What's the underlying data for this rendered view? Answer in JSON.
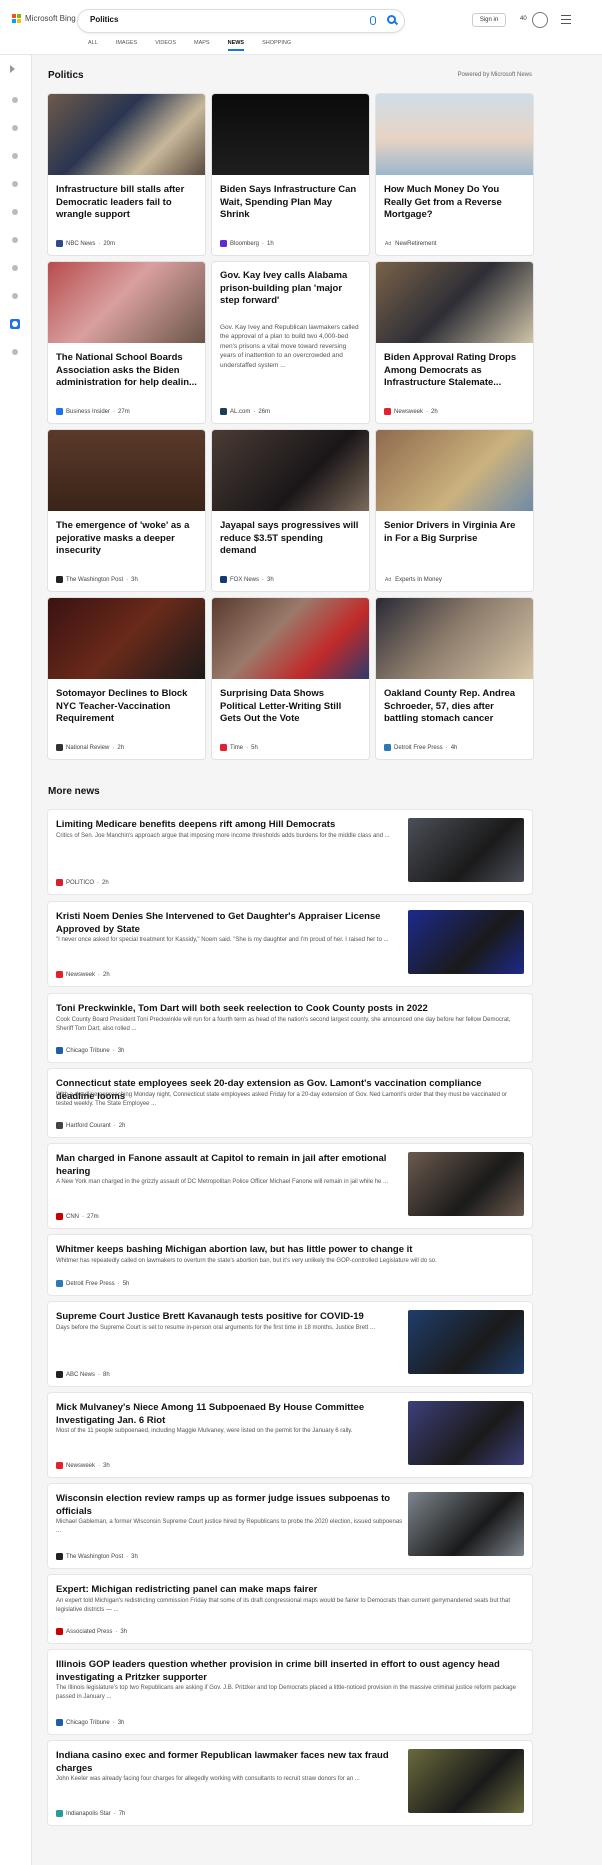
{
  "header": {
    "logo_text": "Microsoft Bing",
    "search_value": "Politics",
    "sign_in": "Sign in",
    "points": "40"
  },
  "tabs": [
    "ALL",
    "IMAGES",
    "VIDEOS",
    "MAPS",
    "NEWS",
    "SHOPPING"
  ],
  "section": {
    "title": "Politics",
    "powered_by": "Powered by Microsoft News"
  },
  "cards": [
    {
      "title": "Infrastructure bill stalls after Democratic leaders fail to wrangle support",
      "source": "NBC News",
      "time": "20m",
      "icon": "nbc-icon",
      "color": "#2d4a8a"
    },
    {
      "title": "Biden Says Infrastructure Can Wait, Spending Plan May Shrink",
      "source": "Bloomberg",
      "time": "1h",
      "icon": "bloomberg-icon",
      "color": "#5b2bd6"
    },
    {
      "title": "How Much Money Do You Really Get from a Reverse Mortgage?",
      "source": "NewRetirement",
      "time": "",
      "ad": "Ad",
      "icon": "ad-icon",
      "color": "#999999"
    },
    {
      "title": "The National School Boards Association asks the Biden administration for help dealin...",
      "source": "Business Insider",
      "time": "27m",
      "icon": "business-insider-icon",
      "color": "#1a73e8"
    },
    {
      "title": "Gov. Kay Ivey calls Alabama prison-building plan 'major step forward'",
      "desc": "Gov. Kay Ivey and Republican lawmakers called the approval of a plan to build two 4,000-bed men's prisons a vital move toward reversing years of inattention to an overcrowded and understaffed system ...",
      "source": "AL.com",
      "time": "26m",
      "icon": "al-com-icon",
      "color": "#1c3d5a"
    },
    {
      "title": "Biden Approval Rating Drops Among Democrats as Infrastructure Stalemate...",
      "source": "Newsweek",
      "time": "2h",
      "icon": "newsweek-icon",
      "color": "#e4202f"
    },
    {
      "title": "The emergence of 'woke' as a pejorative masks a deeper insecurity",
      "source": "The Washington Post",
      "time": "3h",
      "icon": "washington-post-icon",
      "color": "#222222"
    },
    {
      "title": "Jayapal says progressives will reduce $3.5T spending demand",
      "source": "FOX News",
      "time": "3h",
      "icon": "fox-news-icon",
      "color": "#103a74"
    },
    {
      "title": "Senior Drivers in Virginia Are in For a Big Surprise",
      "source": "Experts In Money",
      "time": "",
      "ad": "Ad",
      "icon": "ad-icon",
      "color": "#999999"
    },
    {
      "title": "Sotomayor Declines to Block NYC Teacher-Vaccination Requirement",
      "source": "National Review",
      "time": "2h",
      "icon": "national-review-icon",
      "color": "#333333"
    },
    {
      "title": "Surprising Data Shows Political Letter-Writing Still Gets Out the Vote",
      "source": "Time",
      "time": "5h",
      "icon": "time-icon",
      "color": "#e4202f"
    },
    {
      "title": "Oakland County Rep. Andrea Schroeder, 57, dies after battling stomach cancer",
      "source": "Detroit Free Press",
      "time": "4h",
      "icon": "detroit-free-press-icon",
      "color": "#2a7ab8"
    }
  ],
  "more_news": {
    "title": "More news",
    "items": [
      {
        "title": "Limiting Medicare benefits deepens rift among Hill Democrats",
        "desc": "Critics of Sen. Joe Manchin's approach argue that imposing more income thresholds adds burdens for the middle class and ...",
        "source": "POLITICO",
        "time": "2h",
        "icon": "politico-icon",
        "color": "#d4202f",
        "thumb": "#4b4f58"
      },
      {
        "title": "Kristi Noem Denies She Intervened to Get Daughter's Appraiser License Approved by State",
        "desc": "\"I never once asked for special treatment for Kassidy,\" Noem said. \"She is my daughter and I'm proud of her. I raised her to ...",
        "source": "Newsweek",
        "time": "2h",
        "icon": "newsweek-icon",
        "color": "#e4202f",
        "thumb": "#1c2a8c"
      },
      {
        "title": "Toni Preckwinkle, Tom Dart will both seek reelection to Cook County posts in 2022",
        "desc": "Cook County Board President Toni Preckwinkle will run for a fourth term as head of the nation's second largest county, she announced one day before her fellow Democrat, Sheriff Tom Dart, also rolled ...",
        "source": "Chicago Tribune",
        "time": "3h",
        "icon": "chicago-tribune-icon",
        "color": "#1c5fa8"
      },
      {
        "title": "Connecticut state employees seek 20-day extension as Gov. Lamont's vaccination compliance deadline looms",
        "desc": "With a deadline approaching Monday night, Connecticut state employees asked Friday for a 20-day extension of Gov. Ned Lamont's order that they must be vaccinated or tested weekly. The State Employee ...",
        "source": "Hartford Courant",
        "time": "2h",
        "icon": "hartford-courant-icon",
        "color": "#444444"
      },
      {
        "title": "Man charged in Fanone assault at Capitol to remain in jail after emotional hearing",
        "desc": "A New York man charged in the grizzly assault of DC Metropolitan Police Officer Michael Fanone will remain in jail while he ...",
        "source": "CNN",
        "time": "27m",
        "icon": "cnn-icon",
        "color": "#cc0000",
        "thumb": "#6b5a4e"
      },
      {
        "title": "Whitmer keeps bashing Michigan abortion law, but has little power to change it",
        "desc": "Whitmer has repeatedly called on lawmakers to overturn the state's abortion ban, but it's very unlikely the GOP-controlled Legislature will do so.",
        "source": "Detroit Free Press",
        "time": "5h",
        "icon": "detroit-free-press-icon",
        "color": "#2a7ab8"
      },
      {
        "title": "Supreme Court Justice Brett Kavanaugh tests positive for COVID-19",
        "desc": "Days before the Supreme Court is set to resume in-person oral arguments for the first time in 18 months, Justice Brett ...",
        "source": "ABC News",
        "time": "8h",
        "icon": "abc-news-icon",
        "color": "#222222",
        "thumb": "#1f3d6b"
      },
      {
        "title": "Mick Mulvaney's Niece Among 11 Subpoenaed By House Committee Investigating Jan. 6 Riot",
        "desc": "Most of the 11 people subpoenaed, including Maggie Mulvaney, were listed on the permit for the January 6 rally.",
        "source": "Newsweek",
        "time": "3h",
        "icon": "newsweek-icon",
        "color": "#e4202f",
        "thumb": "#3d3f7a"
      },
      {
        "title": "Wisconsin election review ramps up as former judge issues subpoenas to officials",
        "desc": "Michael Gableman, a former Wisconsin Supreme Court justice hired by Republicans to probe the 2020 election, issued subpoenas ...",
        "source": "The Washington Post",
        "time": "3h",
        "icon": "washington-post-icon",
        "color": "#222222",
        "thumb": "#7d858d"
      },
      {
        "title": "Expert: Michigan redistricting panel can make maps fairer",
        "desc": "An expert told Michigan's redistricting commission Friday that some of its draft congressional maps would be fairer to Democrats than current gerrymandered seats but that legislative districts — ...",
        "source": "Associated Press",
        "time": "3h",
        "icon": "associated-press-icon",
        "color": "#cc0000"
      },
      {
        "title": "Illinois GOP leaders question whether provision in crime bill inserted in effort to oust agency head investigating a Pritzker supporter",
        "desc": "The Illinois legislature's top two Republicans are asking if Gov. J.B. Pritzker and top Democrats placed a little-noticed provision in the massive criminal justice reform package passed in January ...",
        "source": "Chicago Tribune",
        "time": "3h",
        "icon": "chicago-tribune-icon",
        "color": "#1c5fa8"
      },
      {
        "title": "Indiana casino exec and former Republican lawmaker faces new tax fraud charges",
        "desc": "John Keeler was already facing four charges for allegedly working with consultants to recruit straw donors for an ...",
        "source": "Indianapolis Star",
        "time": "7h",
        "icon": "indianapolis-star-icon",
        "color": "#2a9b9b",
        "thumb": "#6a6a3e"
      }
    ]
  },
  "colors": {
    "accent": "#1a73e8"
  }
}
